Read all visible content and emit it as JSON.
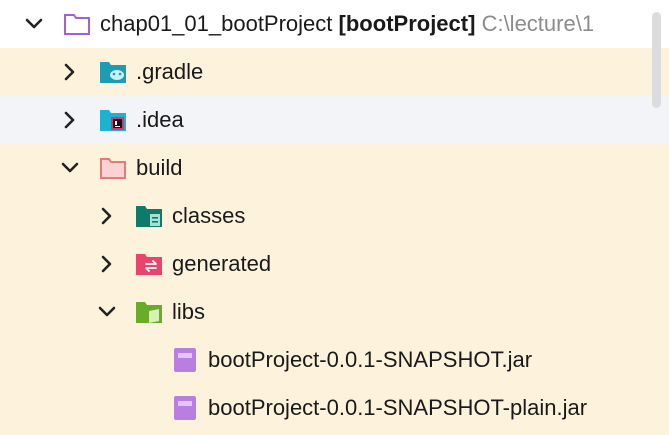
{
  "project": {
    "name": "chap01_01_bootProject",
    "module_badge": "[bootProject]",
    "path": "C:\\lecture\\1"
  },
  "tree": {
    "gradle": ".gradle",
    "idea": ".idea",
    "build": "build",
    "classes": "classes",
    "generated": "generated",
    "libs": "libs",
    "jar1": "bootProject-0.0.1-SNAPSHOT.jar",
    "jar2": "bootProject-0.0.1-SNAPSHOT-plain.jar"
  },
  "icons": {
    "project": "folder-outline-icon",
    "gradle": "gradle-folder-icon",
    "idea": "intellij-folder-icon",
    "build": "build-folder-icon",
    "classes": "classes-folder-icon",
    "generated": "generated-folder-icon",
    "libs": "libs-folder-icon",
    "jar": "jar-file-icon"
  },
  "colors": {
    "yellow_row": "#fdf3dc",
    "hover_row": "#f3f4f8",
    "path_text": "#8c8c8c"
  }
}
